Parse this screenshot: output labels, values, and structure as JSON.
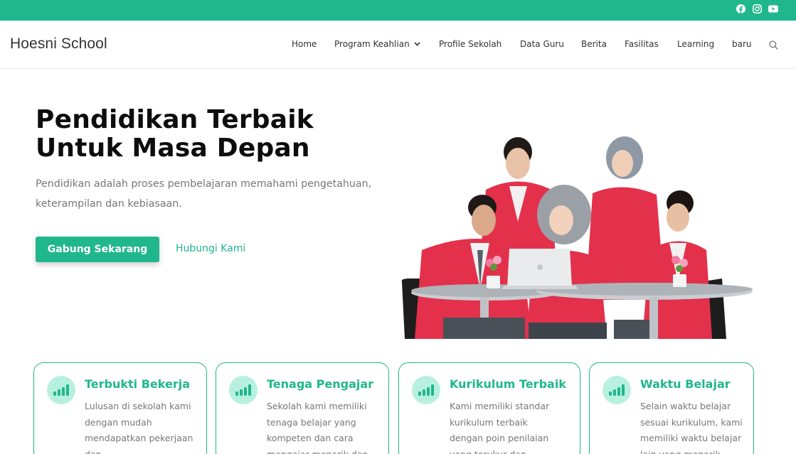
{
  "colors": {
    "accent": "#20b78c",
    "icon_bg": "#b8f0df"
  },
  "topbar": {
    "social": [
      "facebook-icon",
      "instagram-icon",
      "youtube-icon"
    ]
  },
  "header": {
    "brand": "Hoesni School",
    "nav": [
      "Home",
      "Program Keahlian",
      "Profile Sekolah",
      "Data Guru",
      "Berita",
      "Fasilitas",
      "Learning",
      "baru"
    ]
  },
  "hero": {
    "title_line1": "Pendidikan Terbaik",
    "title_line2": "Untuk Masa Depan",
    "subtitle": "Pendidikan adalah proses pembelajaran memahami pengetahuan, keterampilan dan kebiasaan.",
    "cta_primary": "Gabung Sekarang",
    "cta_secondary": "Hubungi Kami"
  },
  "features": [
    {
      "title": "Terbukti Bekerja",
      "text": "Lulusan di sekolah kami dengan mudah mendapatkan pekerjaan dan"
    },
    {
      "title": "Tenaga Pengajar",
      "text": "Sekolah kami memiliki tenaga belajar yang kompeten dan cara mengajar menarik dan"
    },
    {
      "title": "Kurikulum Terbaik",
      "text": "Kami memiliki standar kurikulum terbaik dengan poin penilaian yang terukur dan"
    },
    {
      "title": "Waktu Belajar",
      "text": "Selain waktu belajar sesuai kurikulum, kami memiliki waktu belajar lain yang menarik"
    }
  ]
}
